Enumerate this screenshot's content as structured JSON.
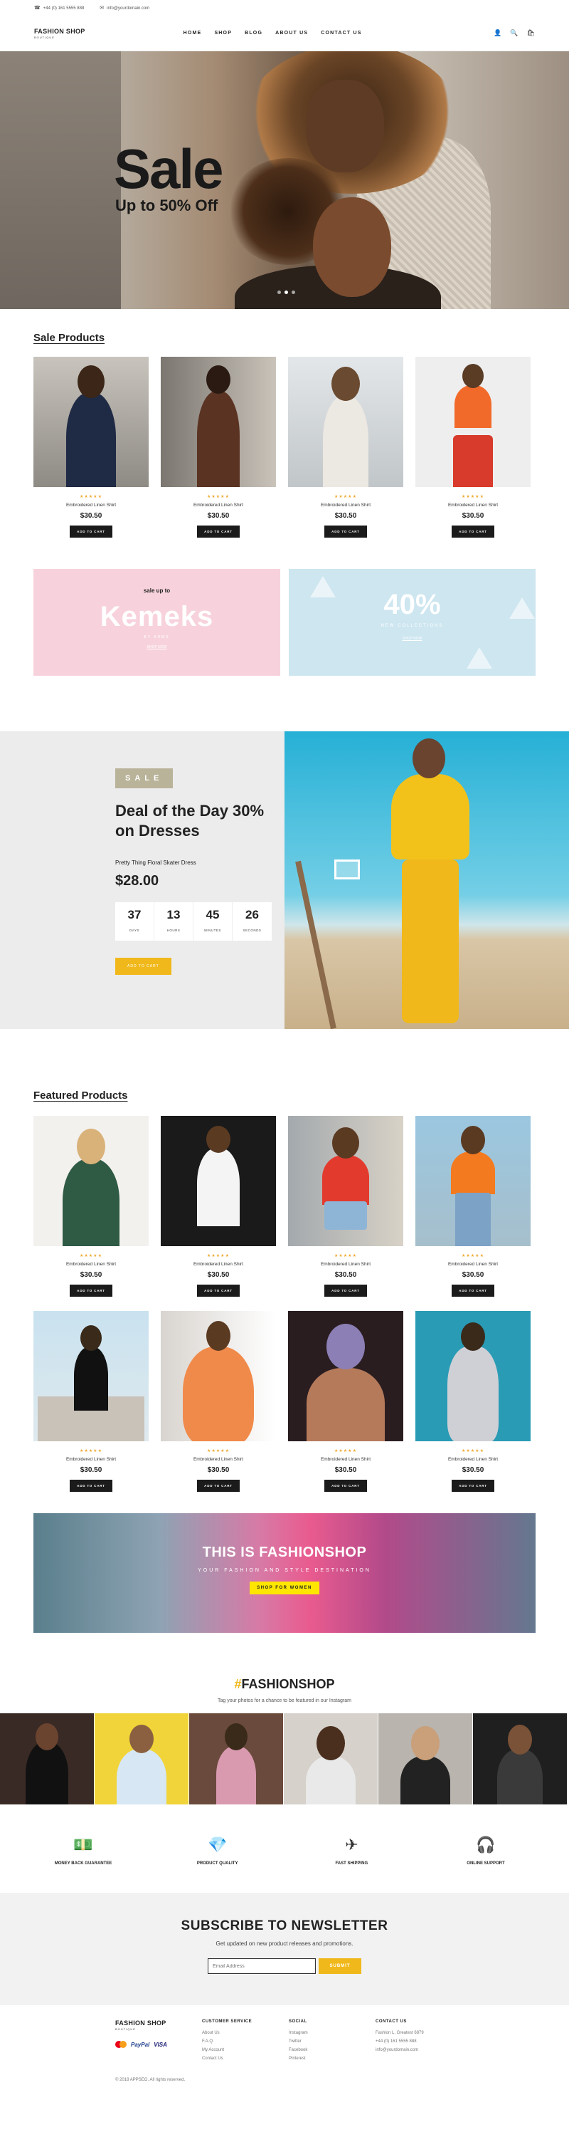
{
  "topbar": {
    "phone": "+44 (0) 161 5555 888",
    "email": "info@yourdomain.com"
  },
  "header": {
    "logo": "FASHION SHOP",
    "tagline": "BOUTIQUE",
    "nav": [
      "HOME",
      "SHOP",
      "BLOG",
      "ABOUT US",
      "CONTACT US"
    ]
  },
  "hero": {
    "title": "Sale",
    "subtitle": "Up to 50% Off"
  },
  "sale": {
    "title": "Sale Products",
    "products": [
      {
        "name": "Embroidered Linen Shirt",
        "price": "$30.50",
        "btn": "ADD TO CART",
        "stars": "★★★★★"
      },
      {
        "name": "Embroidered Linen Shirt",
        "price": "$30.50",
        "btn": "ADD TO CART",
        "stars": "★★★★★"
      },
      {
        "name": "Embroidered Linen Shirt",
        "price": "$30.50",
        "btn": "ADD TO CART",
        "stars": "★★★★★"
      },
      {
        "name": "Embroidered Linen Shirt",
        "price": "$30.50",
        "btn": "ADD TO CART",
        "stars": "★★★★★"
      }
    ]
  },
  "promo": {
    "left": {
      "line1": "sale up to",
      "brand": "Kemeks",
      "sub": "BY ARMS",
      "link": "SHOP NOW"
    },
    "right": {
      "pct": "40%",
      "sub": "NEW COLLECTIONS",
      "link": "SHOP NOW"
    }
  },
  "deal": {
    "badge": "SALE",
    "title": "Deal of the Day 30% on Dresses",
    "product": "Pretty Thing Floral Skater Dress",
    "price": "$28.00",
    "countdown": [
      {
        "v": "37",
        "l": "DAYS"
      },
      {
        "v": "13",
        "l": "HOURS"
      },
      {
        "v": "45",
        "l": "MINUTES"
      },
      {
        "v": "26",
        "l": "SECONDS"
      }
    ],
    "btn": "ADD TO CART"
  },
  "featured": {
    "title": "Featured Products",
    "products": [
      {
        "name": "Embroidered Linen Shirt",
        "price": "$30.50",
        "btn": "ADD TO CART",
        "stars": "★★★★★"
      },
      {
        "name": "Embroidered Linen Shirt",
        "price": "$30.50",
        "btn": "ADD TO CART",
        "stars": "★★★★★"
      },
      {
        "name": "Embroidered Linen Shirt",
        "price": "$30.50",
        "btn": "ADD TO CART",
        "stars": "★★★★★"
      },
      {
        "name": "Embroidered Linen Shirt",
        "price": "$30.50",
        "btn": "ADD TO CART",
        "stars": "★★★★★"
      },
      {
        "name": "Embroidered Linen Shirt",
        "price": "$30.50",
        "btn": "ADD TO CART",
        "stars": "★★★★★"
      },
      {
        "name": "Embroidered Linen Shirt",
        "price": "$30.50",
        "btn": "ADD TO CART",
        "stars": "★★★★★"
      },
      {
        "name": "Embroidered Linen Shirt",
        "price": "$30.50",
        "btn": "ADD TO CART",
        "stars": "★★★★★"
      },
      {
        "name": "Embroidered Linen Shirt",
        "price": "$30.50",
        "btn": "ADD TO CART",
        "stars": "★★★★★"
      }
    ]
  },
  "banner": {
    "title": "THIS IS FASHIONSHOP",
    "sub": "YOUR FASHION AND STYLE DESTINATION",
    "btn": "SHOP FOR WOMEN"
  },
  "instagram": {
    "hash": "#",
    "title": "FASHIONSHOP",
    "sub": "Tag your photos for a chance to be featured in our Instagram"
  },
  "features": [
    {
      "icon": "money-icon",
      "glyph": "💵",
      "name": "MONEY BACK GUARANTEE"
    },
    {
      "icon": "diamond-icon",
      "glyph": "💎",
      "name": "PRODUCT QUALITY"
    },
    {
      "icon": "plane-icon",
      "glyph": "✈",
      "name": "FAST SHIPPING"
    },
    {
      "icon": "headset-icon",
      "glyph": "🎧",
      "name": "ONLINE SUPPORT"
    }
  ],
  "newsletter": {
    "title": "SUBSCRIBE TO NEWSLETTER",
    "sub": "Get updated on new product releases and promotions.",
    "placeholder": "Email Address",
    "btn": "SUBMIT"
  },
  "footer": {
    "logo": "FASHION SHOP",
    "tagline": "BOUTIQUE",
    "customer": {
      "title": "CUSTOMER SERVICE",
      "links": [
        "About Us",
        "F.A.Q.",
        "My Account",
        "Contact Us"
      ]
    },
    "social": {
      "title": "SOCIAL",
      "links": [
        "Instagram",
        "Twitter",
        "Facebook",
        "Pinterest"
      ]
    },
    "contact": {
      "title": "CONTACT US",
      "lines": [
        "Fashion L, Greatest 6879",
        "+44 (0) 161 5555 888",
        "info@yourdomain.com"
      ]
    },
    "pay": [
      "PayPal",
      "VISA"
    ],
    "copyright": "© 2018 APPSEO. All rights reserved."
  },
  "colors": {
    "accent": "#f0b81a",
    "dark": "#1b1b1b",
    "pink": "#f7d2dc",
    "blue": "#cde6f0"
  }
}
